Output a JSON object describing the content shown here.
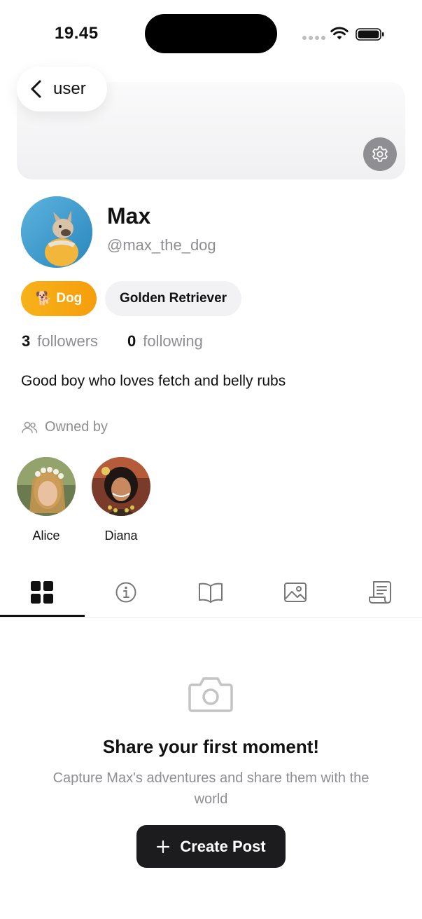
{
  "status_bar": {
    "time": "19.45"
  },
  "header": {
    "back_label": "user"
  },
  "profile": {
    "name": "Max",
    "handle": "@max_the_dog",
    "species_tag": "Dog",
    "species_emoji": "🐕",
    "breed_tag": "Golden Retriever",
    "followers_count": "3",
    "followers_label": "followers",
    "following_count": "0",
    "following_label": "following",
    "bio": "Good boy who loves fetch and belly rubs"
  },
  "owners": {
    "heading": "Owned by",
    "list": [
      {
        "name": "Alice"
      },
      {
        "name": "Diana"
      }
    ]
  },
  "tabs": [
    {
      "icon": "grid-icon",
      "active": true
    },
    {
      "icon": "info-icon",
      "active": false
    },
    {
      "icon": "book-icon",
      "active": false
    },
    {
      "icon": "photo-icon",
      "active": false
    },
    {
      "icon": "receipt-icon",
      "active": false
    }
  ],
  "empty_state": {
    "icon": "camera-icon",
    "title": "Share your first moment!",
    "subtitle": "Capture Max's adventures and share them with the world",
    "button_label": "Create Post"
  },
  "colors": {
    "accent_dog_tag": "#f5a70f",
    "button_dark": "#1c1c1e",
    "muted_text": "#8e8e93"
  }
}
